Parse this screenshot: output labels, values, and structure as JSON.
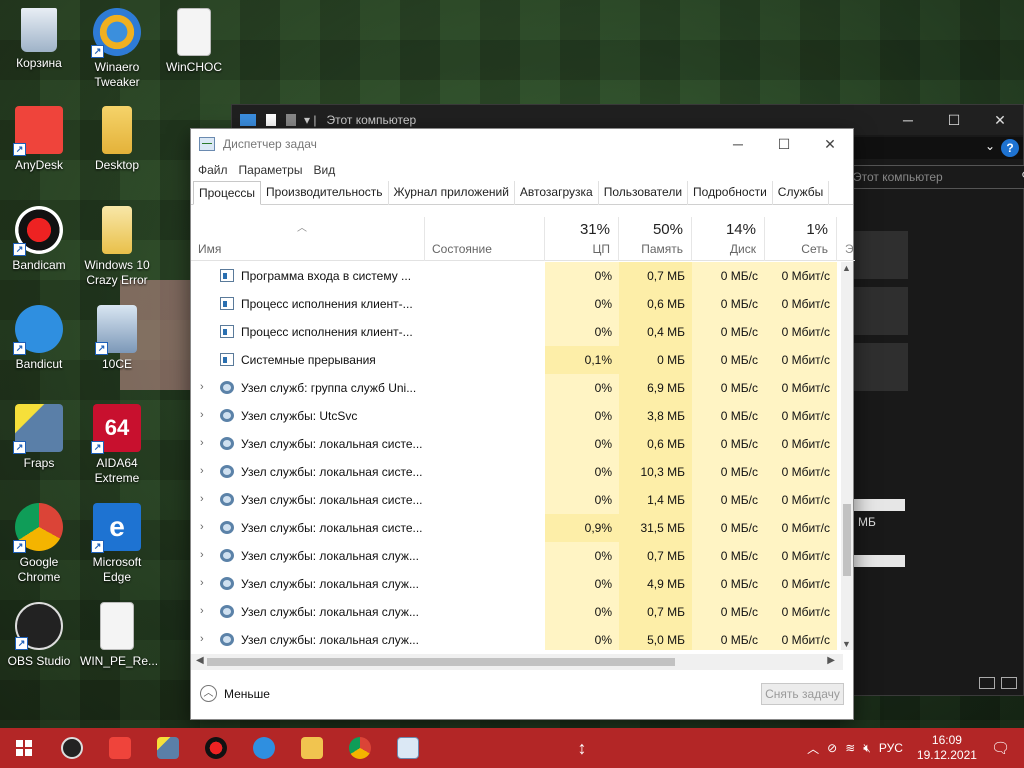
{
  "desktop": {
    "icons": [
      {
        "label": "Корзина"
      },
      {
        "label": "Winaero Tweaker"
      },
      {
        "label": "WinCHOC"
      },
      {
        "label": "AnyDesk"
      },
      {
        "label": "Desktop"
      },
      {
        "label": "Bandicam"
      },
      {
        "label": "Windows 10 Crazy Error"
      },
      {
        "label": "Bandicut"
      },
      {
        "label": "10CE"
      },
      {
        "label": "Fraps"
      },
      {
        "label": "AIDA64 Extreme"
      },
      {
        "label": "Google Chrome"
      },
      {
        "label": "Microsoft Edge"
      },
      {
        "label": "OBS Studio"
      },
      {
        "label": "WIN_PE_Re..."
      }
    ]
  },
  "explorer": {
    "title": "Этот компьютер",
    "search_placeholder": "Этот компьютер",
    "size_label": "МБ"
  },
  "taskmgr": {
    "title": "Диспетчер задач",
    "menu": [
      "Файл",
      "Параметры",
      "Вид"
    ],
    "tabs": [
      "Процессы",
      "Производительность",
      "Журнал приложений",
      "Автозагрузка",
      "Пользователи",
      "Подробности",
      "Службы"
    ],
    "columns": {
      "name": "Имя",
      "status": "Состояние",
      "cpu": {
        "pct": "31%",
        "label": "ЦП"
      },
      "mem": {
        "pct": "50%",
        "label": "Память"
      },
      "disk": {
        "pct": "14%",
        "label": "Диск"
      },
      "net": {
        "pct": "1%",
        "label": "Сеть"
      },
      "next": "Э"
    },
    "rows": [
      {
        "expand": false,
        "icon": "win",
        "name": "Программа входа в систему ...",
        "cpu": "0%",
        "mem": "0,7 МБ",
        "disk": "0 МБ/с",
        "net": "0 Мбит/с"
      },
      {
        "expand": false,
        "icon": "win",
        "name": "Процесс исполнения клиент-...",
        "cpu": "0%",
        "mem": "0,6 МБ",
        "disk": "0 МБ/с",
        "net": "0 Мбит/с"
      },
      {
        "expand": false,
        "icon": "win",
        "name": "Процесс исполнения клиент-...",
        "cpu": "0%",
        "mem": "0,4 МБ",
        "disk": "0 МБ/с",
        "net": "0 Мбит/с"
      },
      {
        "expand": false,
        "icon": "win",
        "name": "Системные прерывания",
        "cpu": "0,1%",
        "mem": "0 МБ",
        "disk": "0 МБ/с",
        "net": "0 Мбит/с"
      },
      {
        "expand": true,
        "icon": "gear",
        "name": "Узел служб: группа служб Uni...",
        "cpu": "0%",
        "mem": "6,9 МБ",
        "disk": "0 МБ/с",
        "net": "0 Мбит/с"
      },
      {
        "expand": true,
        "icon": "gear",
        "name": "Узел службы: UtcSvc",
        "cpu": "0%",
        "mem": "3,8 МБ",
        "disk": "0 МБ/с",
        "net": "0 Мбит/с"
      },
      {
        "expand": true,
        "icon": "gear",
        "name": "Узел службы: локальная систе...",
        "cpu": "0%",
        "mem": "0,6 МБ",
        "disk": "0 МБ/с",
        "net": "0 Мбит/с"
      },
      {
        "expand": true,
        "icon": "gear",
        "name": "Узел службы: локальная систе...",
        "cpu": "0%",
        "mem": "10,3 МБ",
        "disk": "0 МБ/с",
        "net": "0 Мбит/с"
      },
      {
        "expand": true,
        "icon": "gear",
        "name": "Узел службы: локальная систе...",
        "cpu": "0%",
        "mem": "1,4 МБ",
        "disk": "0 МБ/с",
        "net": "0 Мбит/с"
      },
      {
        "expand": true,
        "icon": "gear",
        "name": "Узел службы: локальная систе...",
        "cpu": "0,9%",
        "mem": "31,5 МБ",
        "disk": "0 МБ/с",
        "net": "0 Мбит/с"
      },
      {
        "expand": true,
        "icon": "gear",
        "name": "Узел службы: локальная служ...",
        "cpu": "0%",
        "mem": "0,7 МБ",
        "disk": "0 МБ/с",
        "net": "0 Мбит/с"
      },
      {
        "expand": true,
        "icon": "gear",
        "name": "Узел службы: локальная служ...",
        "cpu": "0%",
        "mem": "4,9 МБ",
        "disk": "0 МБ/с",
        "net": "0 Мбит/с"
      },
      {
        "expand": true,
        "icon": "gear",
        "name": "Узел службы: локальная служ...",
        "cpu": "0%",
        "mem": "0,7 МБ",
        "disk": "0 МБ/с",
        "net": "0 Мбит/с"
      },
      {
        "expand": true,
        "icon": "gear",
        "name": "Узел службы: локальная служ...",
        "cpu": "0%",
        "mem": "5,0 МБ",
        "disk": "0 МБ/с",
        "net": "0 Мбит/с"
      }
    ],
    "footer": {
      "less": "Меньше",
      "end_task": "Снять задачу"
    }
  },
  "taskbar": {
    "lang": "РУС",
    "time": "16:09",
    "date": "19.12.2021"
  },
  "colors": {
    "taskbar": "#b32626",
    "heat_light": "#fff4c4",
    "heat_mid": "#fdeea8",
    "accent": "#1e73d2"
  }
}
